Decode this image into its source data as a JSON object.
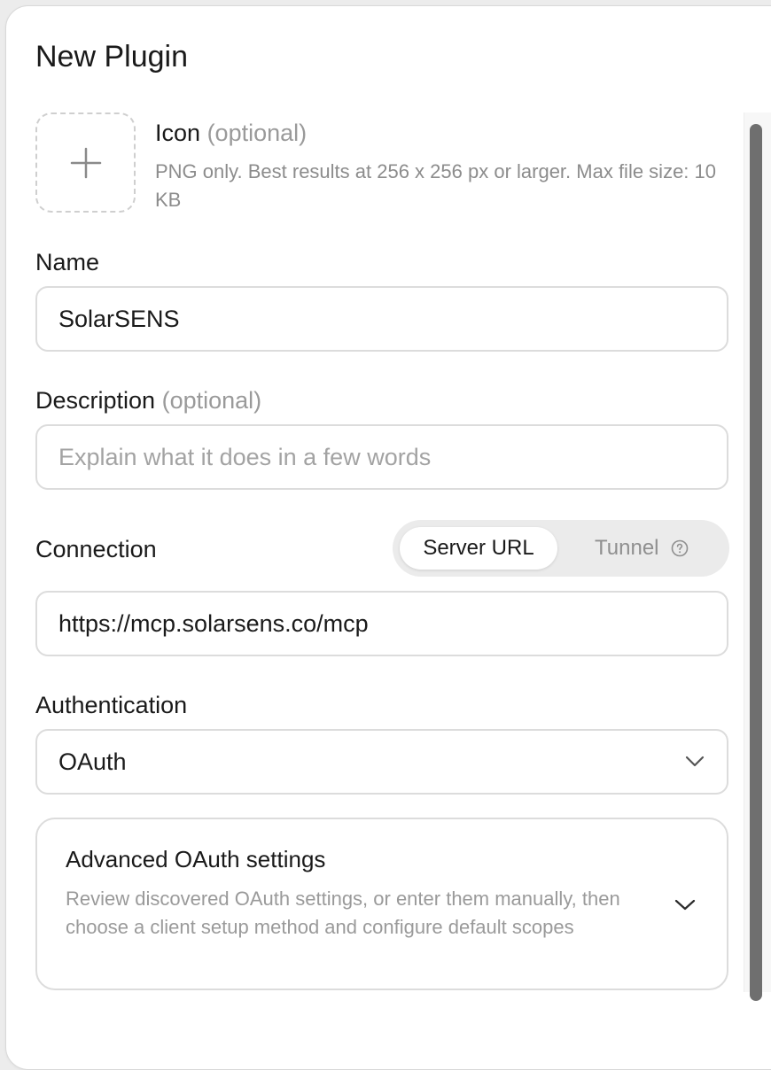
{
  "dialog": {
    "title": "New Plugin"
  },
  "icon_section": {
    "label": "Icon",
    "optional": "(optional)",
    "help": "PNG only. Best results at 256 x 256 px or larger. Max file size: 10 KB",
    "upload_icon": "plus-icon"
  },
  "name_field": {
    "label": "Name",
    "value": "SolarSENS"
  },
  "description_field": {
    "label": "Description",
    "optional": "(optional)",
    "value": "",
    "placeholder": "Explain what it does in a few words"
  },
  "connection": {
    "label": "Connection",
    "options": [
      "Server URL",
      "Tunnel"
    ],
    "selected": "Server URL",
    "tunnel_icon": "help-circle-icon",
    "url_value": "https://mcp.solarsens.co/mcp"
  },
  "authentication": {
    "label": "Authentication",
    "selected": "OAuth",
    "dropdown_icon": "chevron-down-icon"
  },
  "advanced": {
    "title": "Advanced OAuth settings",
    "description": "Review discovered OAuth settings, or enter them manually, then choose a client setup method and configure default scopes",
    "expand_icon": "chevron-down-icon"
  },
  "colors": {
    "background": "#ffffff",
    "border": "#dcdcdc",
    "muted_text": "#9a9a9a",
    "segment_bg": "#ebebeb",
    "scrollbar": "#6f6f6f"
  }
}
